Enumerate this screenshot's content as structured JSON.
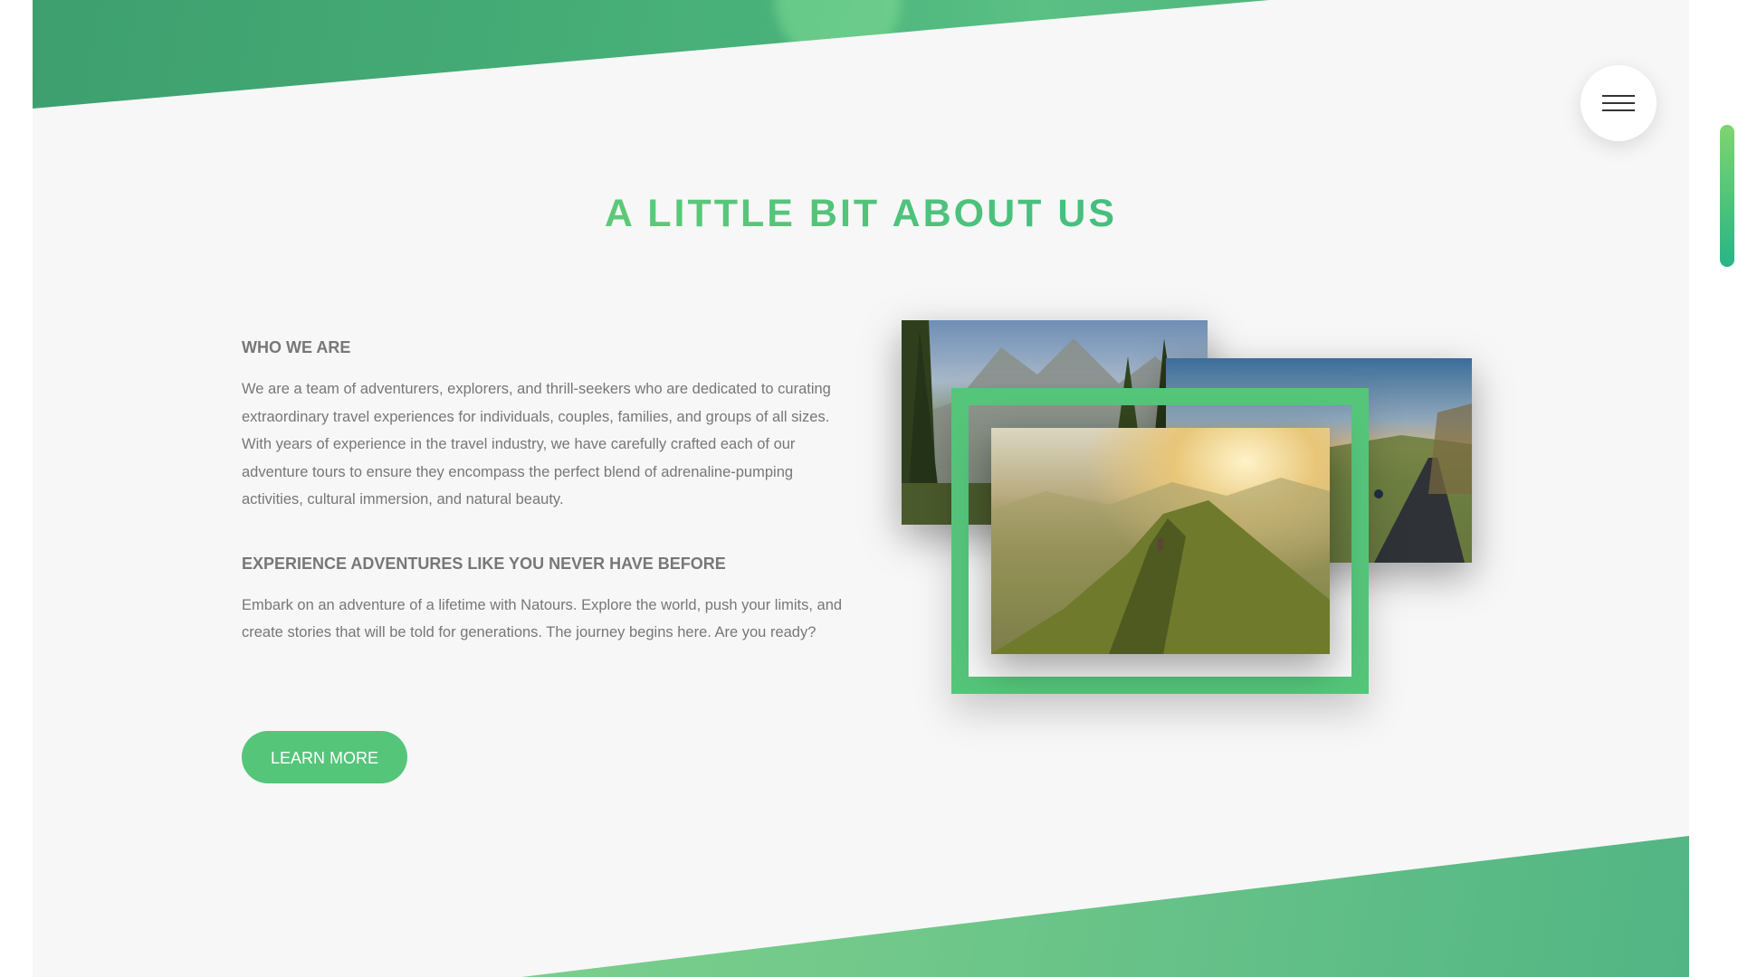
{
  "menu": {
    "icon": "hamburger-menu-icon"
  },
  "section": {
    "title": "A LITTLE BIT ABOUT US"
  },
  "about": {
    "heading_1": "WHO WE ARE",
    "paragraph_1": "We are a team of adventurers, explorers, and thrill-seekers who are dedicated to curating extraordinary travel experiences for individuals, couples, families, and groups of all sizes. With years of experience in the travel industry, we have carefully crafted each of our adventure tours to ensure they encompass the perfect blend of adrenaline-pumping activities, cultural immersion, and natural beauty.",
    "heading_2": "EXPERIENCE ADVENTURES LIKE YOU NEVER HAVE BEFORE",
    "paragraph_2": "Embark on an adventure of a lifetime with Natours. Explore the world, push your limits, and create stories that will be told for generations. The journey begins here. Are you ready?",
    "button_label": "LEARN MORE"
  },
  "colors": {
    "primary": "#55c57a",
    "primary_light": "#7ed56f",
    "primary_dark": "#28b485",
    "text": "#777777",
    "background": "#f7f7f7"
  },
  "composition": {
    "photos": [
      "forest-mountain-photo",
      "road-cyclist-photo",
      "mountain-ridge-photo"
    ]
  }
}
